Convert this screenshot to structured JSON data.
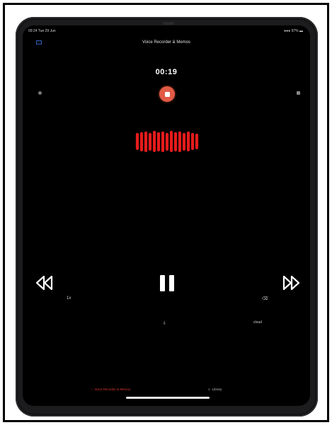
{
  "status_bar": {
    "time": "09:24 Tue 29 Jun",
    "right": "●●● 97% ▬"
  },
  "header": {
    "title": "Voice Recorder & Memos"
  },
  "recording": {
    "elapsed": "00:19"
  },
  "icons": {
    "menu": "book-icon",
    "left_side": "dot-icon",
    "right_side": "square-icon",
    "stop": "stop-icon",
    "rewind": "rewind-icon",
    "pause": "pause-icon",
    "forward": "fast-forward-icon"
  },
  "controls": {
    "left_small": "1x",
    "right_small": "⌫",
    "center_small": "⇩",
    "right_text": "cloud"
  },
  "tabs": [
    {
      "label": "Voice Recorder & Memos",
      "icon": "mic-icon",
      "active": true
    },
    {
      "label": "Library",
      "icon": "list-icon",
      "active": false
    }
  ],
  "colors": {
    "accent": "#e0372c",
    "record_button": "#e15a45",
    "waveform": "#e51b1b",
    "background": "#000000"
  }
}
